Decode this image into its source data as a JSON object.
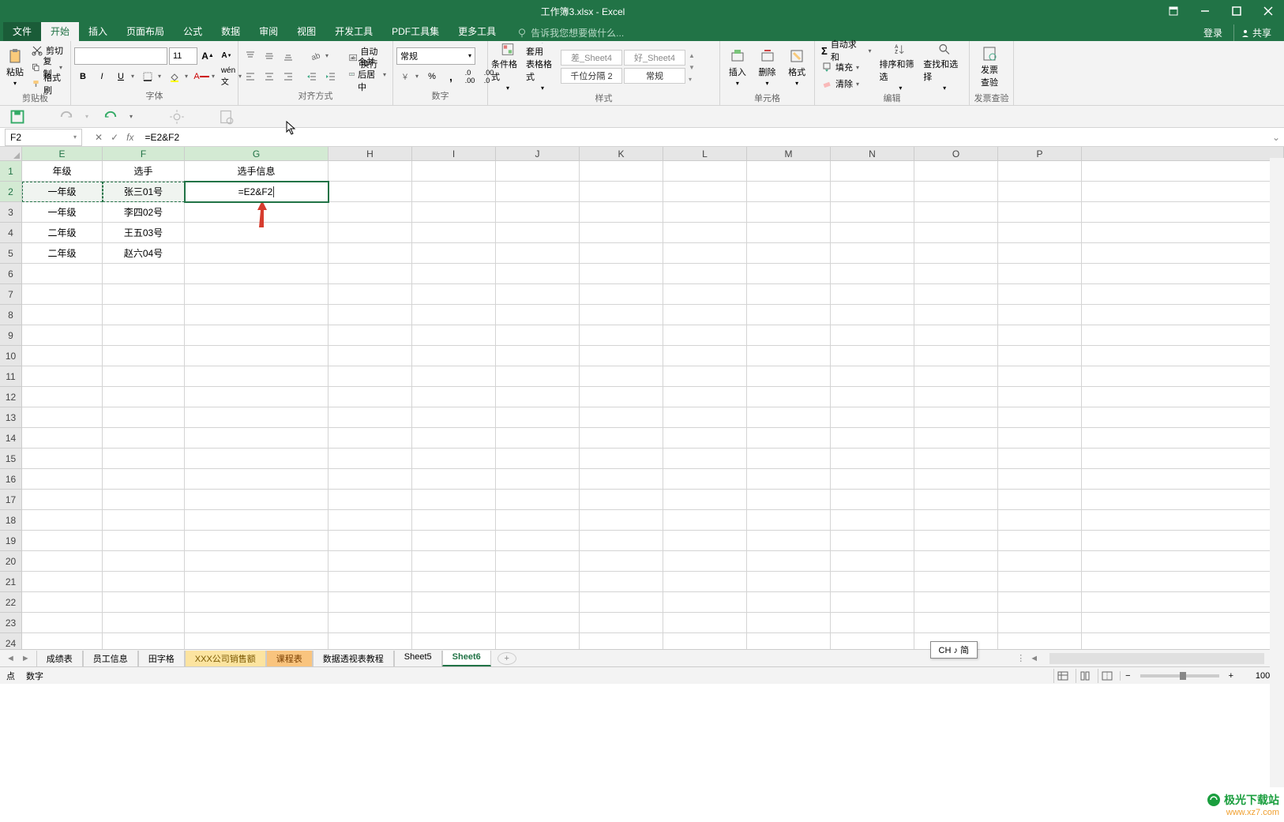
{
  "title": "工作簿3.xlsx - Excel",
  "menu": {
    "file": "文件",
    "home": "开始",
    "insert": "插入",
    "layout": "页面布局",
    "formulas": "公式",
    "data": "数据",
    "review": "审阅",
    "view": "视图",
    "dev": "开发工具",
    "pdf": "PDF工具集",
    "more": "更多工具",
    "tellme": "告诉我您想要做什么...",
    "login": "登录",
    "share": "共享"
  },
  "ribbon": {
    "clipboard": {
      "label": "剪贴板",
      "cut": "剪切",
      "copy": "复制",
      "brush": "格式刷",
      "paste": "粘贴"
    },
    "font": {
      "label": "字体",
      "name": "",
      "size": "11"
    },
    "align": {
      "label": "对齐方式",
      "wrap": "自动换行",
      "merge": "合并后居中"
    },
    "number": {
      "label": "数字",
      "format": "常规"
    },
    "styles": {
      "label": "样式",
      "cond": "条件格式",
      "table": "套用\n表格格式",
      "s1": "差_Sheet4",
      "s2": "好_Sheet4",
      "s3": "千位分隔 2",
      "s4": "常规"
    },
    "cells": {
      "label": "单元格",
      "insert": "插入",
      "delete": "删除",
      "format": "格式"
    },
    "editing": {
      "label": "编辑",
      "sum": "自动求和",
      "fill": "填充",
      "clear": "清除",
      "sort": "排序和筛选",
      "find": "查找和选择"
    },
    "invoice": {
      "label": "发票查验",
      "btn": "发票\n查验"
    }
  },
  "namebox": "F2",
  "formula": "=E2&F2",
  "columns": [
    "E",
    "F",
    "G",
    "H",
    "I",
    "J",
    "K",
    "L",
    "M",
    "N",
    "O",
    "P"
  ],
  "col_widths": {
    "E": 102,
    "F": 104,
    "G": 182,
    "default": 106
  },
  "table": {
    "headers": {
      "E": "年级",
      "F": "选手",
      "G": "选手信息"
    },
    "rows": [
      {
        "E": "一年级",
        "F": "张三01号",
        "G": "=E2&F2"
      },
      {
        "E": "一年级",
        "F": "李四02号",
        "G": ""
      },
      {
        "E": "二年级",
        "F": "王五03号",
        "G": ""
      },
      {
        "E": "二年级",
        "F": "赵六04号",
        "G": ""
      }
    ]
  },
  "sheets": [
    "成绩表",
    "员工信息",
    "田字格",
    "XXX公司销售额",
    "课程表",
    "数据透视表教程",
    "Sheet5",
    "Sheet6"
  ],
  "active_sheet": "Sheet6",
  "status": {
    "left1": "点",
    "left2": "数字"
  },
  "ime": "CH ♪ 简",
  "watermark": {
    "brand": "极光下载站",
    "url": "www.xz7.com"
  },
  "zoom": "100%"
}
